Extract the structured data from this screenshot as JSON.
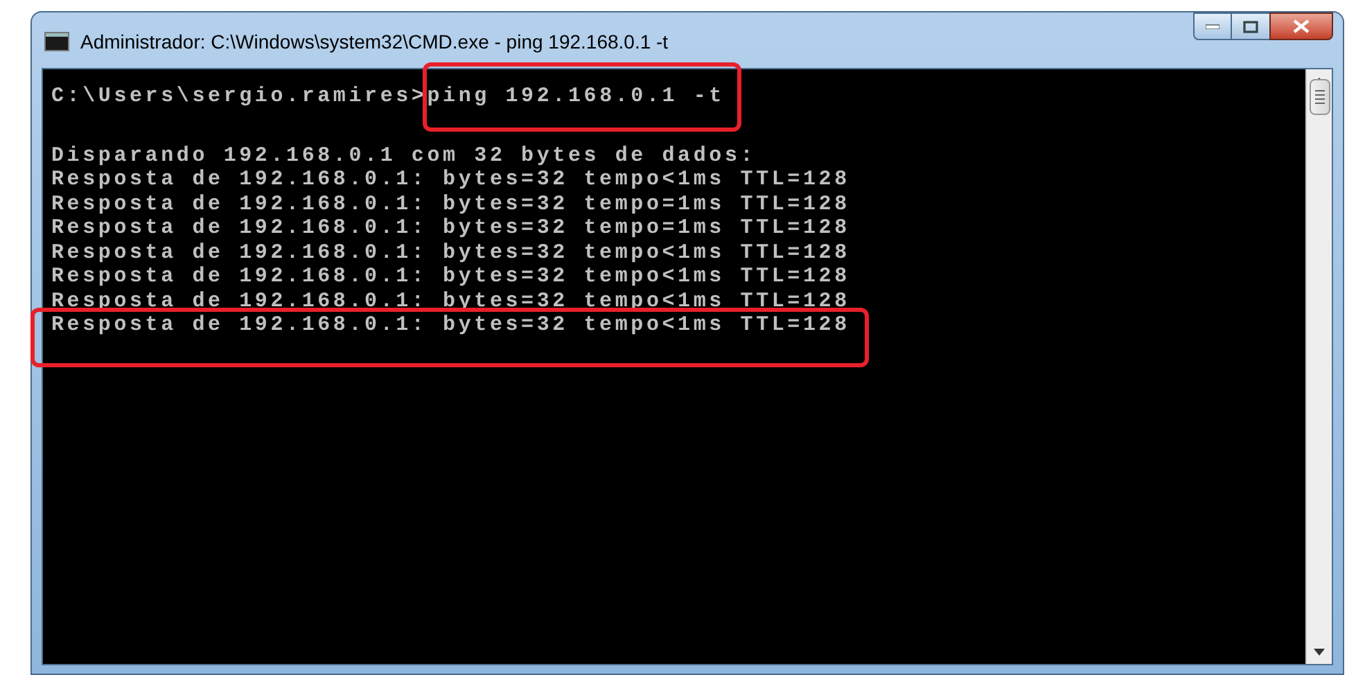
{
  "window": {
    "title": "Administrador: C:\\Windows\\system32\\CMD.exe - ping  192.168.0.1 -t"
  },
  "console": {
    "prompt": "C:\\Users\\sergio.ramires>",
    "command": {
      "text": "ping 192.168.0.1 -t",
      "highlighted": true
    },
    "output_lines": [
      {
        "text": "Disparando 192.168.0.1 com 32 bytes de dados:",
        "highlighted": false
      },
      {
        "text": "Resposta de 192.168.0.1: bytes=32 tempo<1ms TTL=128",
        "highlighted": false
      },
      {
        "text": "Resposta de 192.168.0.1: bytes=32 tempo=1ms TTL=128",
        "highlighted": false
      },
      {
        "text": "Resposta de 192.168.0.1: bytes=32 tempo=1ms TTL=128",
        "highlighted": false
      },
      {
        "text": "Resposta de 192.168.0.1: bytes=32 tempo<1ms TTL=128",
        "highlighted": false
      },
      {
        "text": "Resposta de 192.168.0.1: bytes=32 tempo<1ms TTL=128",
        "highlighted": false
      },
      {
        "text": "Resposta de 192.168.0.1: bytes=32 tempo<1ms TTL=128",
        "highlighted": false
      },
      {
        "text": "Resposta de 192.168.0.1: bytes=32 tempo<1ms TTL=128",
        "highlighted": true
      }
    ]
  }
}
